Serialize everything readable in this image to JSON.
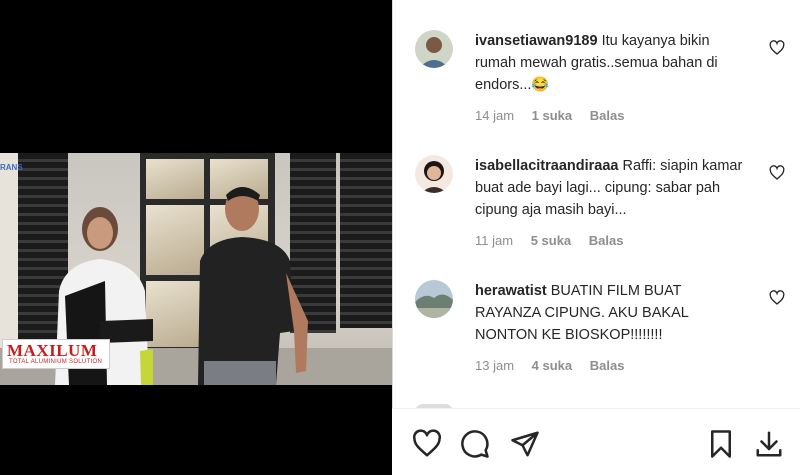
{
  "video": {
    "brand_logo_text": "RANS",
    "sponsor_name": "MAXILUM",
    "sponsor_tagline": "TOTAL ALUMINIUM SOLUTION"
  },
  "comments": [
    {
      "username": "ivansetiawan9189",
      "text": "Itu kayanya bikin rumah mewah gratis..semua bahan di endors...😂",
      "time": "14 jam",
      "likes": "1 suka",
      "reply": "Balas"
    },
    {
      "username": "isabellacitraandiraaa",
      "text": "Raffi: siapin kamar buat ade bayi lagi... cipung: sabar pah cipung aja masih bayi...",
      "time": "11 jam",
      "likes": "5 suka",
      "reply": "Balas"
    },
    {
      "username": "herawatist",
      "text": "BUATIN FILM BUAT RAYANZA CIPUNG. AKU BAKAL NONTON KE BIOSKOP!!!!!!!!",
      "time": "13 jam",
      "likes": "4 suka",
      "reply": "Balas"
    }
  ],
  "icons": {
    "like": "heart-icon",
    "comment": "comment-icon",
    "share": "share-icon",
    "save": "bookmark-icon",
    "download": "download-icon",
    "comment_like": "heart-icon"
  },
  "colors": {
    "text": "#262626",
    "meta": "#8e8e8e",
    "sponsor_red": "#c81d1d"
  }
}
